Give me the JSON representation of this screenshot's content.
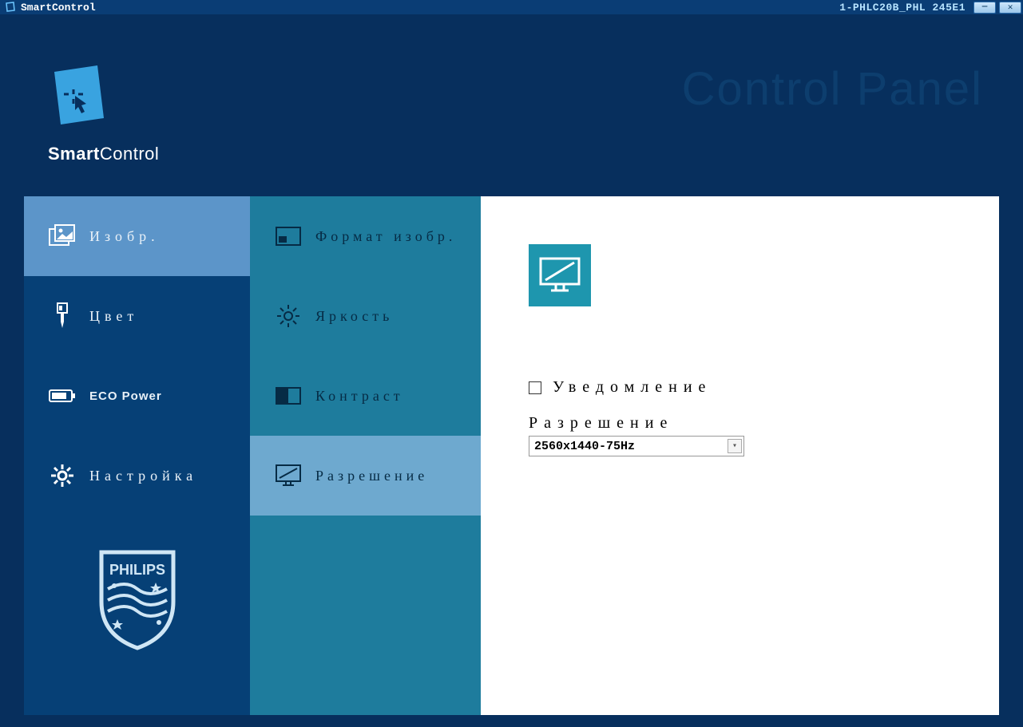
{
  "titlebar": {
    "app_name": "SmartControl",
    "monitor_id": "1-PHLC20B_PHL 245E1"
  },
  "header": {
    "brand_bold": "Smart",
    "brand_rest": "Control",
    "page_title": "Control Panel"
  },
  "nav": {
    "items": [
      {
        "key": "image",
        "label": "Изобр."
      },
      {
        "key": "color",
        "label": "Цвет"
      },
      {
        "key": "eco",
        "label": "ECO Power"
      },
      {
        "key": "settings",
        "label": "Настройка"
      }
    ]
  },
  "subnav": {
    "items": [
      {
        "key": "format",
        "label": "Формат изобр."
      },
      {
        "key": "brightness",
        "label": "Яркость"
      },
      {
        "key": "contrast",
        "label": "Контраст"
      },
      {
        "key": "resolution",
        "label": "Разрешение"
      }
    ]
  },
  "content": {
    "notify_label": "Уведомление",
    "resolution_label": "Разрешение",
    "resolution_value": "2560x1440-75Hz"
  },
  "brand": {
    "philips": "PHILIPS"
  }
}
